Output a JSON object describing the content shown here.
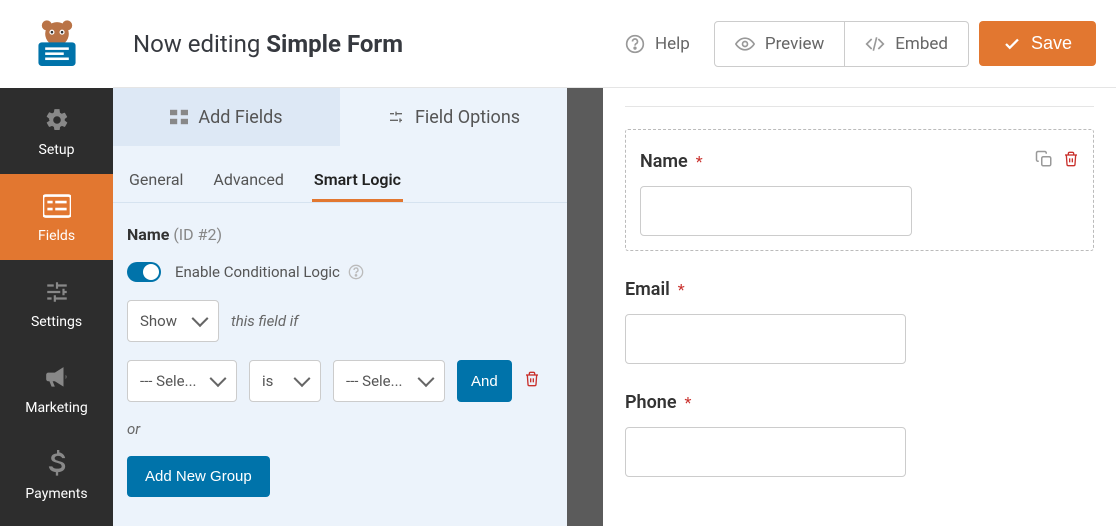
{
  "topbar": {
    "editing_prefix": "Now editing ",
    "form_name": "Simple Form",
    "help_label": "Help",
    "preview_label": "Preview",
    "embed_label": "Embed",
    "save_label": "Save"
  },
  "sidebar": {
    "items": [
      {
        "id": "setup",
        "label": "Setup"
      },
      {
        "id": "fields",
        "label": "Fields"
      },
      {
        "id": "settings",
        "label": "Settings"
      },
      {
        "id": "marketing",
        "label": "Marketing"
      },
      {
        "id": "payments",
        "label": "Payments"
      }
    ],
    "active": "fields"
  },
  "panel": {
    "tabs": {
      "add_fields": "Add Fields",
      "field_options": "Field Options"
    },
    "active_tab": "field_options",
    "sub_tabs": {
      "general": "General",
      "advanced": "Advanced",
      "smart_logic": "Smart Logic"
    },
    "active_sub_tab": "smart_logic",
    "field_name": "Name",
    "field_id_label": "(ID #2)",
    "toggle_label": "Enable Conditional Logic",
    "toggle_on": true,
    "logic": {
      "show_select": "Show",
      "hint_text": "this field if",
      "rule": {
        "field_select": "--- Sele...",
        "operator_select": "is",
        "value_select": "--- Sele..."
      },
      "and_label": "And",
      "or_label": "or",
      "new_group_label": "Add New Group"
    }
  },
  "preview": {
    "fields": [
      {
        "label": "Name",
        "required": true,
        "selected": true
      },
      {
        "label": "Email",
        "required": true,
        "selected": false
      },
      {
        "label": "Phone",
        "required": true,
        "selected": false
      }
    ]
  }
}
